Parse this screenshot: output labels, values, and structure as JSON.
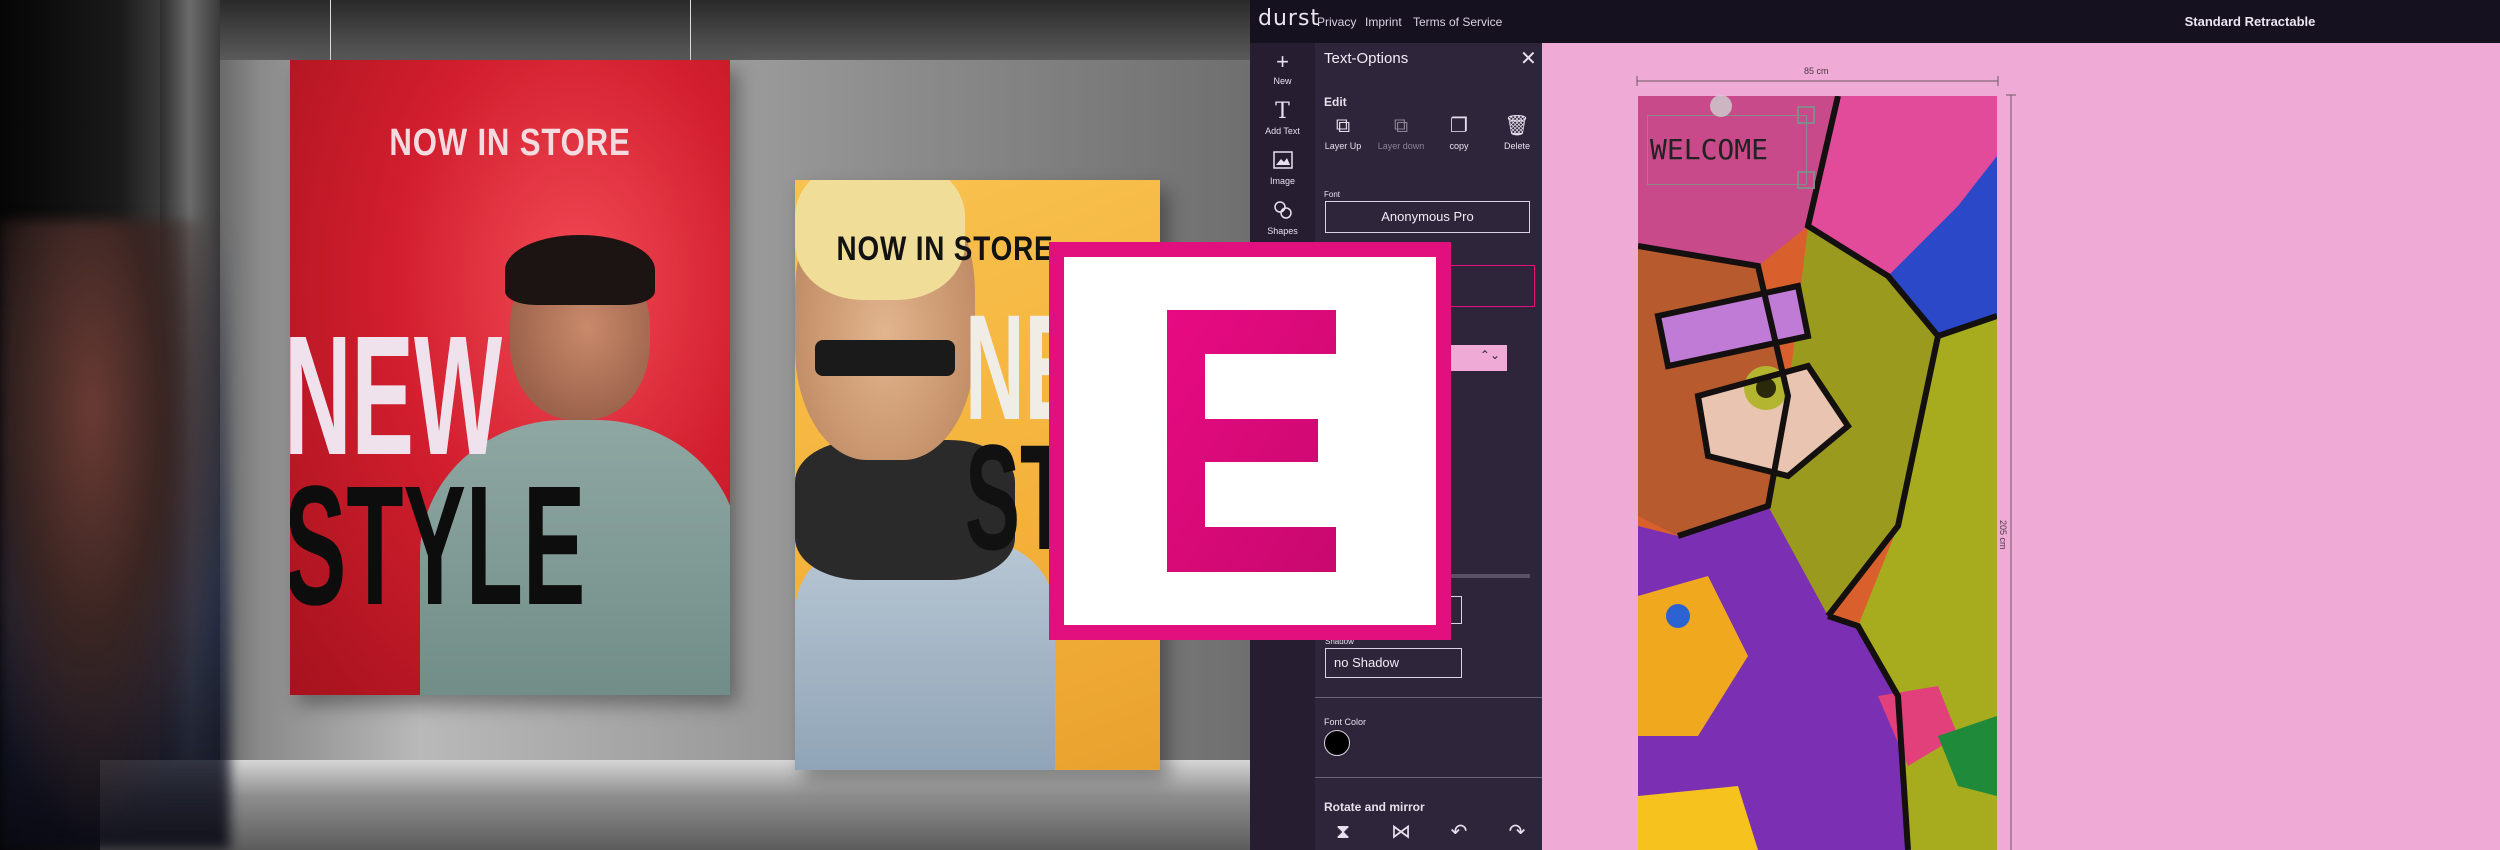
{
  "scene": {
    "poster_red": {
      "kicker": "NOW IN STORE",
      "line1": "NEW",
      "line2": "STYLE"
    },
    "poster_yellow": {
      "kicker": "NOW IN STORE",
      "line1": "NE",
      "line2": "ST"
    }
  },
  "logo": {
    "letter": "E",
    "color": "#e2107f"
  },
  "topbar": {
    "brand": "durst",
    "links": [
      "Privacy",
      "Imprint",
      "Terms of Service"
    ],
    "product_title": "Standard Retractable"
  },
  "toolbar": {
    "items": [
      {
        "label": "New",
        "icon": "plus-icon"
      },
      {
        "label": "Add Text",
        "icon": "text-icon"
      },
      {
        "label": "Image",
        "icon": "image-icon"
      },
      {
        "label": "Shapes",
        "icon": "shapes-icon"
      }
    ]
  },
  "panel": {
    "title": "Text-Options",
    "edit_label": "Edit",
    "edit_buttons": [
      {
        "label": "Layer Up",
        "icon": "layer-up-icon"
      },
      {
        "label": "Layer down",
        "icon": "layer-down-icon"
      },
      {
        "label": "copy",
        "icon": "copy-icon"
      },
      {
        "label": "Delete",
        "icon": "trash-icon"
      }
    ],
    "font_label": "Font",
    "font_value": "Anonymous Pro",
    "shadow_label": "Shadow",
    "shadow_value": "no Shadow",
    "font_color_label": "Font Color",
    "font_color": "#000000",
    "rotate_label": "Rotate and mirror",
    "rotate_buttons": [
      "flip-vertical-icon",
      "flip-horizontal-icon",
      "rotate-left-icon",
      "rotate-right-icon"
    ]
  },
  "canvas": {
    "width_label": "85 cm",
    "height_label": "205 cm",
    "text_element": "WELCOME",
    "background_color": "#efaad6"
  }
}
